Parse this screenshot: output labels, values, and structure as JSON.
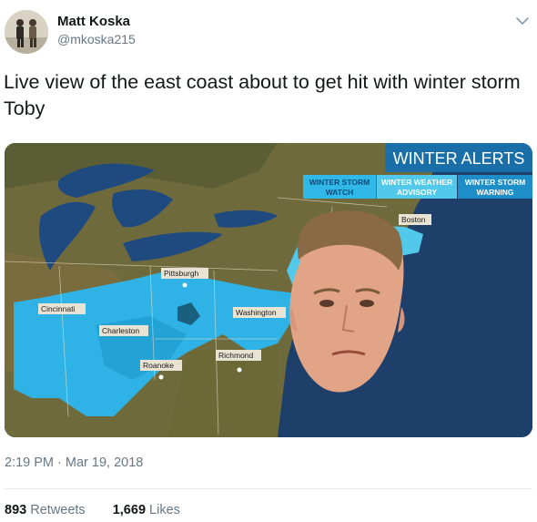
{
  "tweet": {
    "author": {
      "display_name": "Matt Koska",
      "handle": "@mkoska215"
    },
    "text": "Live view of the east coast about to get hit with winter storm Toby",
    "timestamp": "2:19 PM · Mar 19, 2018",
    "retweets": {
      "count": "893",
      "label": "Retweets"
    },
    "likes": {
      "count": "1,669",
      "label": "Likes"
    }
  },
  "media": {
    "banner_title": "WINTER ALERTS",
    "legend": [
      {
        "line1": "WINTER STORM",
        "line2": "WATCH",
        "color": "#2fb8e8"
      },
      {
        "line1": "WINTER WEATHER",
        "line2": "ADVISORY",
        "color": "#52c9ea"
      },
      {
        "line1": "WINTER STORM",
        "line2": "WARNING",
        "color": "#1e8ec8"
      }
    ],
    "cities": [
      "Boston",
      "Pittsburgh",
      "Cincinnati",
      "Washington",
      "Charleston",
      "Richmond",
      "Roanoke"
    ]
  },
  "colors": {
    "text_primary": "#14171a",
    "text_secondary": "#657786",
    "ocean": "#1d3f6a",
    "storm_zone": "#2fb3e6"
  }
}
